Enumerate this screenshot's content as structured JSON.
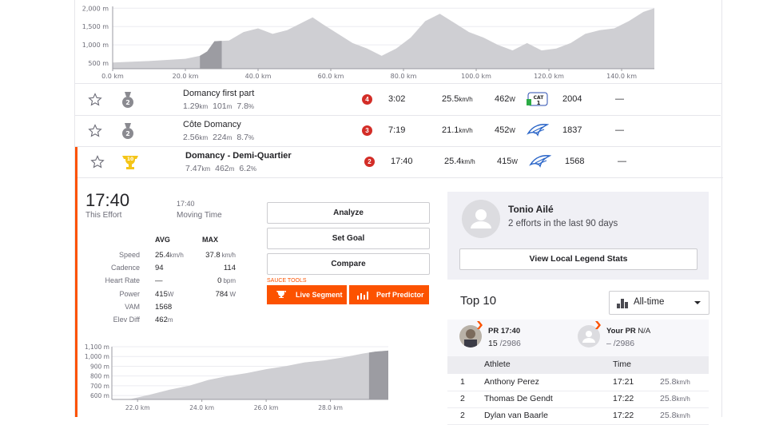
{
  "top_chart": {
    "y_ticks": [
      "2,000 m",
      "1,500 m",
      "1,000 m",
      "500 m"
    ],
    "x_ticks": [
      "0.0 km",
      "20.0 km",
      "40.0 km",
      "60.0 km",
      "80.0 km",
      "100.0 km",
      "120.0 km",
      "140.0 km"
    ],
    "profile_km": [
      0,
      10,
      20,
      24,
      26,
      28,
      32,
      36,
      40,
      44,
      48,
      52,
      55,
      58,
      62,
      66,
      70,
      74,
      78,
      82,
      86,
      90,
      94,
      98,
      102,
      106,
      110,
      114,
      118,
      122,
      126,
      130,
      134,
      138,
      142,
      146,
      149
    ],
    "profile_m": [
      520,
      560,
      620,
      700,
      820,
      1100,
      1120,
      1350,
      1450,
      1300,
      1400,
      1600,
      1750,
      1550,
      1300,
      1050,
      900,
      700,
      900,
      1200,
      1650,
      1850,
      1600,
      1350,
      1200,
      1000,
      850,
      1050,
      850,
      900,
      1050,
      1300,
      1400,
      1450,
      1650,
      1900,
      2000
    ],
    "highlight_km": [
      24,
      30
    ],
    "colors": {
      "fill": "#cfcfd3",
      "highlight": "#9c9ca2"
    }
  },
  "segments": [
    {
      "name": "Domancy first part",
      "dist": "1.29",
      "dist_u": "km",
      "elev": "101",
      "elev_u": "m",
      "grade": "7.8",
      "grade_u": "%",
      "rank": "4",
      "time": "3:02",
      "speed": "25.5",
      "speed_u": "km/h",
      "power": "462",
      "power_u": "W",
      "score": "2004",
      "dash": "—",
      "medal": "2",
      "icon": "cat-icon"
    },
    {
      "name": "Côte Domancy",
      "dist": "2.56",
      "dist_u": "km",
      "elev": "224",
      "elev_u": "m",
      "grade": "8.7",
      "grade_u": "%",
      "rank": "3",
      "time": "7:19",
      "speed": "21.1",
      "speed_u": "km/h",
      "power": "452",
      "power_u": "W",
      "score": "1837",
      "dash": "—",
      "medal": "2",
      "icon": "wing-icon"
    },
    {
      "name": "Domancy - Demi-Quartier",
      "dist": "7.47",
      "dist_u": "km",
      "elev": "462",
      "elev_u": "m",
      "grade": "6.2",
      "grade_u": "%",
      "rank": "2",
      "time": "17:40",
      "speed": "25.4",
      "speed_u": "km/h",
      "power": "415",
      "power_u": "W",
      "score": "1568",
      "dash": "—",
      "medal": "10",
      "icon": "wing-icon"
    }
  ],
  "effort": {
    "time": "17:40",
    "this_effort": "This Effort",
    "moving_time_value": "17:40",
    "moving_time_label": "Moving Time",
    "col_avg": "AVG",
    "col_max": "MAX",
    "stats": [
      {
        "label": "Speed",
        "avg": "25.4",
        "avg_u": "km/h",
        "max": "37.8",
        "max_u": "km/h"
      },
      {
        "label": "Cadence",
        "avg": "94",
        "avg_u": "",
        "max": "114",
        "max_u": ""
      },
      {
        "label": "Heart Rate",
        "avg": "—",
        "avg_u": "",
        "max": "0",
        "max_u": "bpm"
      },
      {
        "label": "Power",
        "avg": "415",
        "avg_u": "W",
        "max": "784",
        "max_u": "W"
      },
      {
        "label": "VAM",
        "avg": "1568",
        "avg_u": "",
        "max": "",
        "max_u": ""
      },
      {
        "label": "Elev Diff",
        "avg": "462",
        "avg_u": "m",
        "max": "",
        "max_u": ""
      }
    ]
  },
  "actions": {
    "analyze": "Analyze",
    "set_goal": "Set Goal",
    "compare": "Compare",
    "sauce_tools": "SAUCE TOOLS",
    "live_segment": "Live Segment",
    "perf_predictor": "Perf Predictor",
    "accent": "#fc5200"
  },
  "mini_chart": {
    "y_ticks": [
      "1,100 m",
      "1,000 m",
      "900 m",
      "800 m",
      "700 m",
      "600 m"
    ],
    "x_ticks": [
      "22.0 km",
      "24.0 km",
      "26.0 km",
      "28.0 km"
    ],
    "profile_km": [
      21.2,
      21.8,
      22.4,
      23.0,
      23.6,
      24.2,
      24.8,
      25.4,
      26.0,
      26.6,
      27.2,
      27.8,
      28.4,
      29.0,
      29.4,
      29.8
    ],
    "profile_m": [
      560,
      565,
      610,
      660,
      700,
      760,
      800,
      830,
      870,
      900,
      940,
      960,
      990,
      1030,
      1050,
      1060
    ],
    "highlight_km": [
      29.2,
      29.8
    ]
  },
  "legend": {
    "name": "Tonio Ailé",
    "efforts": "2 efforts in the last 90 days",
    "view_btn": "View Local Legend Stats"
  },
  "top10": {
    "title": "Top 10",
    "filter": "All-time",
    "pr_label": "PR 17:40",
    "pr_rank": "15",
    "pr_total": "/2986",
    "your_pr_label": "Your PR",
    "your_pr_value": "N/A",
    "your_rank": "–",
    "your_total": "/2986",
    "col_athlete": "Athlete",
    "col_time": "Time",
    "rows": [
      {
        "rank": "1",
        "athlete": "Anthony Perez",
        "time": "17:21",
        "speed": "25.8",
        "speed_u": "km/h"
      },
      {
        "rank": "2",
        "athlete": "Thomas De Gendt",
        "time": "17:22",
        "speed": "25.8",
        "speed_u": "km/h"
      },
      {
        "rank": "2",
        "athlete": "Dylan van Baarle",
        "time": "17:22",
        "speed": "25.8",
        "speed_u": "km/h"
      }
    ]
  }
}
